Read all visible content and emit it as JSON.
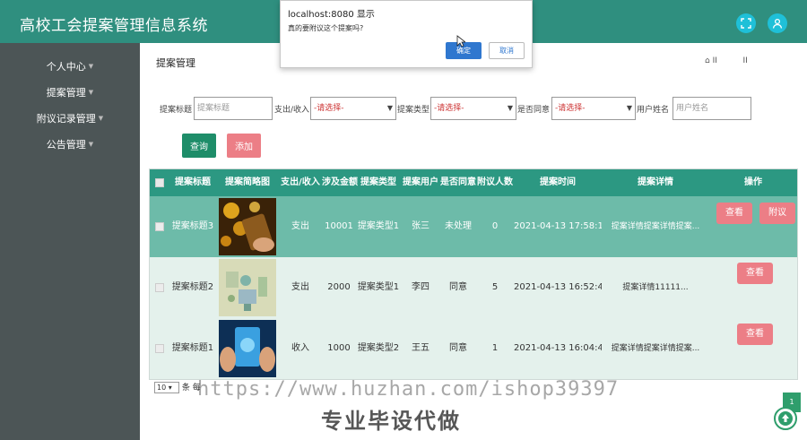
{
  "header": {
    "title": "高校工会提案管理信息系统"
  },
  "sidebar": {
    "items": [
      {
        "label": "个人中心"
      },
      {
        "label": "提案管理"
      },
      {
        "label": "附议记录管理"
      },
      {
        "label": "公告管理"
      }
    ]
  },
  "breadcrumb": {
    "title": "提案管理",
    "icons_text": "⌂ II          II"
  },
  "search": {
    "title_label": "提案标题",
    "title_placeholder": "提案标题",
    "type_label": "支出/收入",
    "type_value": "-请选择-",
    "category_label": "提案类型",
    "category_value": "-请选择-",
    "agree_label": "是否同意",
    "agree_value": "-请选择-",
    "user_label": "用户姓名",
    "user_placeholder": "用户姓名",
    "query_button": "查询",
    "add_button": "添加"
  },
  "table": {
    "headers": [
      "提案标题",
      "提案简略图",
      "支出/收入",
      "涉及金额",
      "提案类型",
      "提案用户",
      "是否同意",
      "附议人数",
      "提案时间",
      "提案详情",
      "操作"
    ],
    "rows": [
      {
        "title": "提案标题3",
        "type": "支出",
        "amount": "10001",
        "category": "提案类型1",
        "user": "张三",
        "agree": "未处理",
        "count": "0",
        "time": "2021-04-13 17:58:12",
        "detail": "提案详情提案详情提案...",
        "actions": [
          "查看",
          "附议"
        ]
      },
      {
        "title": "提案标题2",
        "type": "支出",
        "amount": "2000",
        "category": "提案类型1",
        "user": "李四",
        "agree": "同意",
        "count": "5",
        "time": "2021-04-13 16:52:41",
        "detail": "提案详情11111...",
        "actions": [
          "查看"
        ]
      },
      {
        "title": "提案标题1",
        "type": "收入",
        "amount": "1000",
        "category": "提案类型2",
        "user": "王五",
        "agree": "同意",
        "count": "1",
        "time": "2021-04-13 16:04:49",
        "detail": "提案详情提案详情提案...",
        "actions": [
          "查看"
        ]
      }
    ]
  },
  "pager": {
    "page_size": "10",
    "unit": "条 每",
    "current_page": "1"
  },
  "watermark": {
    "url": "https://www.huzhan.com/ishop39397",
    "slogan": "专业毕设代做"
  },
  "dialog": {
    "title": "localhost:8080 显示",
    "message": "真的要附议这个提案吗?",
    "ok": "确定",
    "cancel": "取消"
  },
  "colors": {
    "header": "#2f8f7f",
    "sidebar": "#4c5556",
    "accent": "#ec7e86",
    "query": "#1e8d69"
  }
}
